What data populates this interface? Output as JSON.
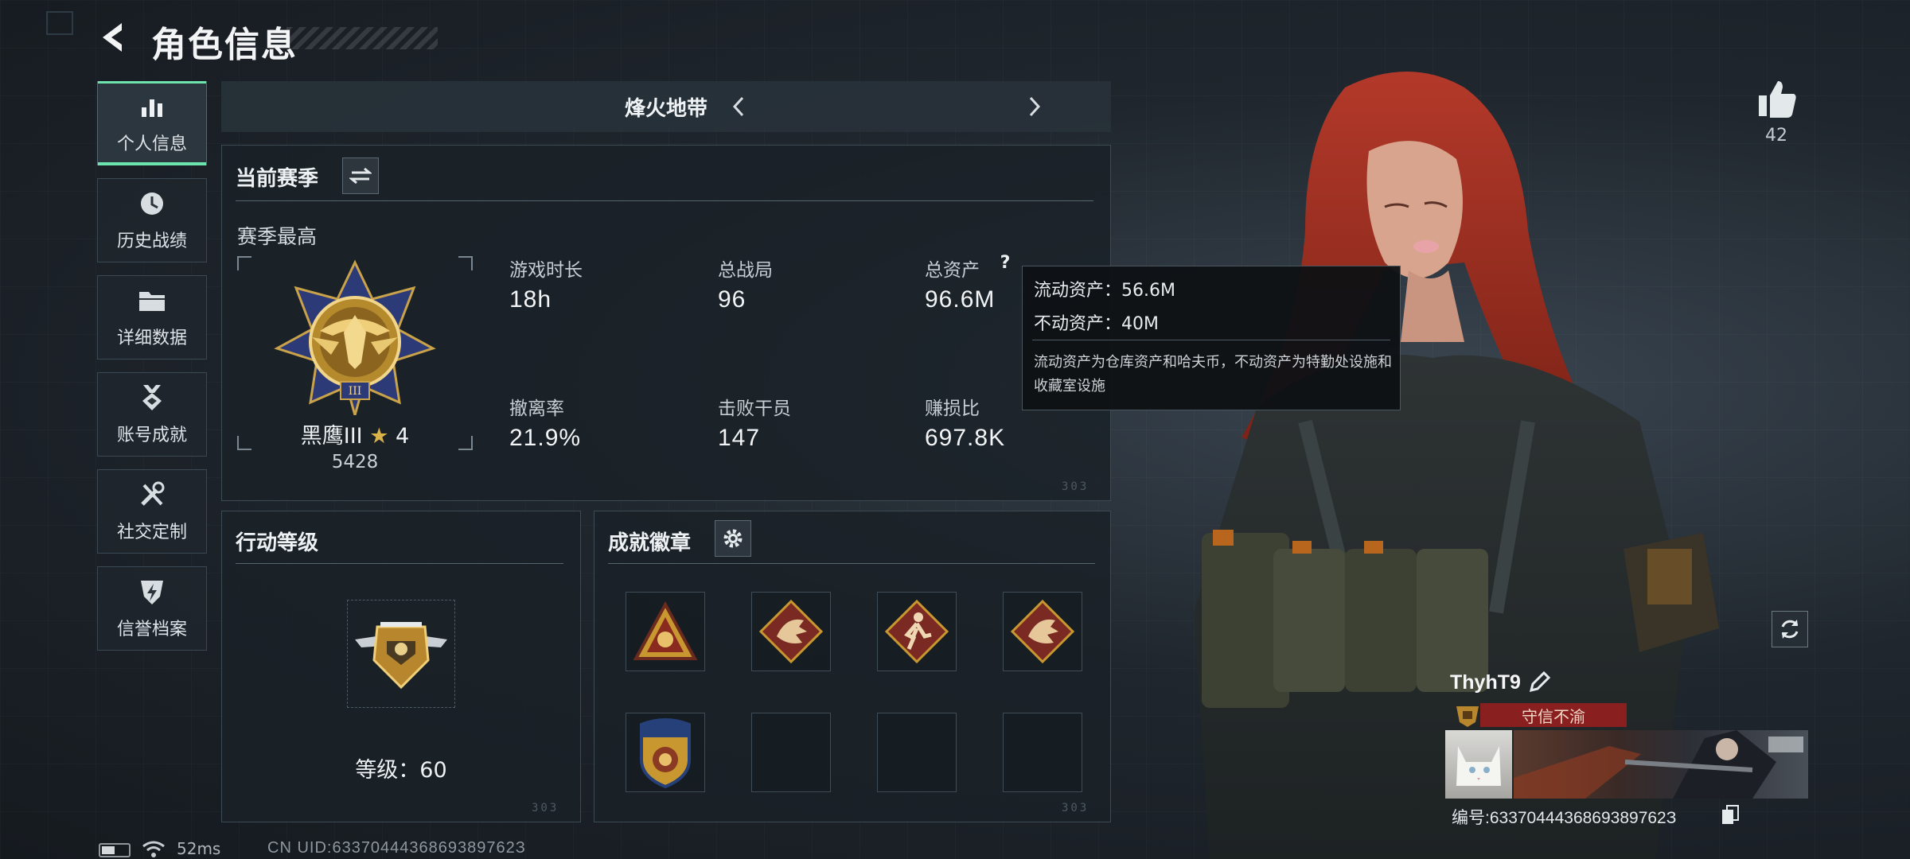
{
  "header": {
    "title": "角色信息"
  },
  "sidebar": {
    "items": [
      {
        "label": "个人信息",
        "icon": "bar-chart-icon",
        "active": true
      },
      {
        "label": "历史战绩",
        "icon": "history-clock-icon"
      },
      {
        "label": "详细数据",
        "icon": "folder-icon"
      },
      {
        "label": "账号成就",
        "icon": "achievement-medal-icon"
      },
      {
        "label": "社交定制",
        "icon": "tools-icon"
      },
      {
        "label": "信誉档案",
        "icon": "shield-bolt-icon"
      }
    ]
  },
  "mode_bar": {
    "title": "烽火地带"
  },
  "season": {
    "title": "当前赛季",
    "subtitle": "赛季最高",
    "rank_name": "黑鹰III",
    "rank_stars": "4",
    "rank_score": "5428",
    "stats": [
      {
        "label": "游戏时长",
        "value": "18h"
      },
      {
        "label": "总战局",
        "value": "96"
      },
      {
        "label": "总资产",
        "value": "96.6M"
      },
      {
        "label": "撤离率",
        "value": "21.9%"
      },
      {
        "label": "击败干员",
        "value": "147"
      },
      {
        "label": "赚损比",
        "value": "697.8K"
      }
    ],
    "help_glyph": "?",
    "corner_code": "303"
  },
  "tooltip": {
    "liquid": "流动资产：56.6M",
    "fixed": "不动资产：40M",
    "description": "流动资产为仓库资产和哈夫币，不动资产为特勤处设施和收藏室设施"
  },
  "action_level": {
    "title": "行动等级",
    "level_text": "等级：60",
    "corner_code": "303"
  },
  "badges": {
    "title": "成就徽章",
    "corner_code": "303",
    "colors": {
      "gold": "#c9972f",
      "red": "#7a2a22",
      "blue": "#26407a"
    }
  },
  "player": {
    "name": "ThyhT9",
    "title": "守信不渝",
    "id_text": "编号:6337044436869389762З"
  },
  "like": {
    "count": "42"
  },
  "status_bar": {
    "ping": "52ms",
    "uid": "CN UID:6337044436869389762З"
  },
  "colors": {
    "accent": "#6de3ad",
    "title_red": "#8a1f1f"
  }
}
